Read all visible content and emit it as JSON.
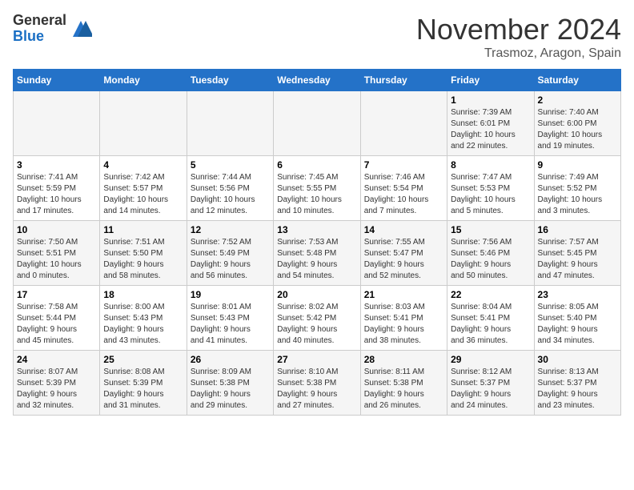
{
  "logo": {
    "general": "General",
    "blue": "Blue"
  },
  "title": "November 2024",
  "location": "Trasmoz, Aragon, Spain",
  "weekdays": [
    "Sunday",
    "Monday",
    "Tuesday",
    "Wednesday",
    "Thursday",
    "Friday",
    "Saturday"
  ],
  "weeks": [
    [
      {
        "day": "",
        "info": ""
      },
      {
        "day": "",
        "info": ""
      },
      {
        "day": "",
        "info": ""
      },
      {
        "day": "",
        "info": ""
      },
      {
        "day": "",
        "info": ""
      },
      {
        "day": "1",
        "info": "Sunrise: 7:39 AM\nSunset: 6:01 PM\nDaylight: 10 hours\nand 22 minutes."
      },
      {
        "day": "2",
        "info": "Sunrise: 7:40 AM\nSunset: 6:00 PM\nDaylight: 10 hours\nand 19 minutes."
      }
    ],
    [
      {
        "day": "3",
        "info": "Sunrise: 7:41 AM\nSunset: 5:59 PM\nDaylight: 10 hours\nand 17 minutes."
      },
      {
        "day": "4",
        "info": "Sunrise: 7:42 AM\nSunset: 5:57 PM\nDaylight: 10 hours\nand 14 minutes."
      },
      {
        "day": "5",
        "info": "Sunrise: 7:44 AM\nSunset: 5:56 PM\nDaylight: 10 hours\nand 12 minutes."
      },
      {
        "day": "6",
        "info": "Sunrise: 7:45 AM\nSunset: 5:55 PM\nDaylight: 10 hours\nand 10 minutes."
      },
      {
        "day": "7",
        "info": "Sunrise: 7:46 AM\nSunset: 5:54 PM\nDaylight: 10 hours\nand 7 minutes."
      },
      {
        "day": "8",
        "info": "Sunrise: 7:47 AM\nSunset: 5:53 PM\nDaylight: 10 hours\nand 5 minutes."
      },
      {
        "day": "9",
        "info": "Sunrise: 7:49 AM\nSunset: 5:52 PM\nDaylight: 10 hours\nand 3 minutes."
      }
    ],
    [
      {
        "day": "10",
        "info": "Sunrise: 7:50 AM\nSunset: 5:51 PM\nDaylight: 10 hours\nand 0 minutes."
      },
      {
        "day": "11",
        "info": "Sunrise: 7:51 AM\nSunset: 5:50 PM\nDaylight: 9 hours\nand 58 minutes."
      },
      {
        "day": "12",
        "info": "Sunrise: 7:52 AM\nSunset: 5:49 PM\nDaylight: 9 hours\nand 56 minutes."
      },
      {
        "day": "13",
        "info": "Sunrise: 7:53 AM\nSunset: 5:48 PM\nDaylight: 9 hours\nand 54 minutes."
      },
      {
        "day": "14",
        "info": "Sunrise: 7:55 AM\nSunset: 5:47 PM\nDaylight: 9 hours\nand 52 minutes."
      },
      {
        "day": "15",
        "info": "Sunrise: 7:56 AM\nSunset: 5:46 PM\nDaylight: 9 hours\nand 50 minutes."
      },
      {
        "day": "16",
        "info": "Sunrise: 7:57 AM\nSunset: 5:45 PM\nDaylight: 9 hours\nand 47 minutes."
      }
    ],
    [
      {
        "day": "17",
        "info": "Sunrise: 7:58 AM\nSunset: 5:44 PM\nDaylight: 9 hours\nand 45 minutes."
      },
      {
        "day": "18",
        "info": "Sunrise: 8:00 AM\nSunset: 5:43 PM\nDaylight: 9 hours\nand 43 minutes."
      },
      {
        "day": "19",
        "info": "Sunrise: 8:01 AM\nSunset: 5:43 PM\nDaylight: 9 hours\nand 41 minutes."
      },
      {
        "day": "20",
        "info": "Sunrise: 8:02 AM\nSunset: 5:42 PM\nDaylight: 9 hours\nand 40 minutes."
      },
      {
        "day": "21",
        "info": "Sunrise: 8:03 AM\nSunset: 5:41 PM\nDaylight: 9 hours\nand 38 minutes."
      },
      {
        "day": "22",
        "info": "Sunrise: 8:04 AM\nSunset: 5:41 PM\nDaylight: 9 hours\nand 36 minutes."
      },
      {
        "day": "23",
        "info": "Sunrise: 8:05 AM\nSunset: 5:40 PM\nDaylight: 9 hours\nand 34 minutes."
      }
    ],
    [
      {
        "day": "24",
        "info": "Sunrise: 8:07 AM\nSunset: 5:39 PM\nDaylight: 9 hours\nand 32 minutes."
      },
      {
        "day": "25",
        "info": "Sunrise: 8:08 AM\nSunset: 5:39 PM\nDaylight: 9 hours\nand 31 minutes."
      },
      {
        "day": "26",
        "info": "Sunrise: 8:09 AM\nSunset: 5:38 PM\nDaylight: 9 hours\nand 29 minutes."
      },
      {
        "day": "27",
        "info": "Sunrise: 8:10 AM\nSunset: 5:38 PM\nDaylight: 9 hours\nand 27 minutes."
      },
      {
        "day": "28",
        "info": "Sunrise: 8:11 AM\nSunset: 5:38 PM\nDaylight: 9 hours\nand 26 minutes."
      },
      {
        "day": "29",
        "info": "Sunrise: 8:12 AM\nSunset: 5:37 PM\nDaylight: 9 hours\nand 24 minutes."
      },
      {
        "day": "30",
        "info": "Sunrise: 8:13 AM\nSunset: 5:37 PM\nDaylight: 9 hours\nand 23 minutes."
      }
    ]
  ]
}
